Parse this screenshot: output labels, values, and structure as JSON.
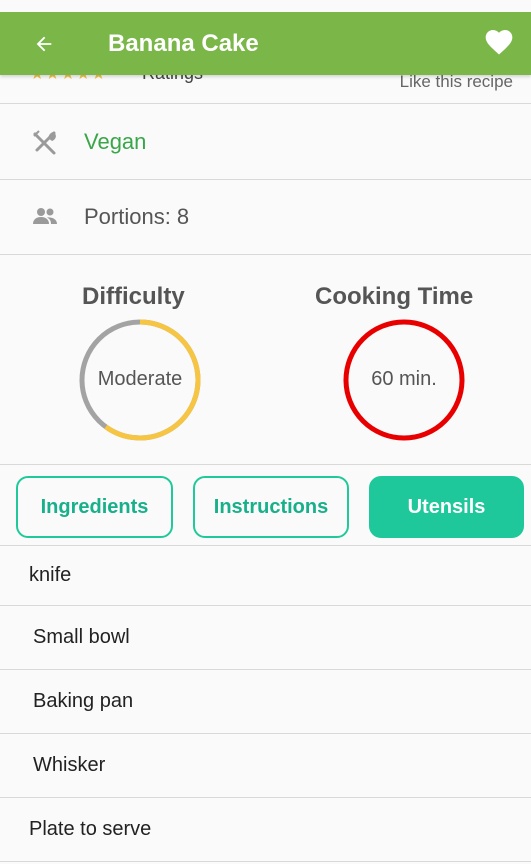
{
  "appbar": {
    "title": "Banana Cake",
    "back_icon": "arrow-left-icon",
    "favorite_icon": "heart-icon",
    "background": "#7ab648"
  },
  "rating": {
    "stars": "★★★★★",
    "ratings_label": "Ratings",
    "like_label": "Like this recipe"
  },
  "diet": {
    "icon": "utensils-cross-icon",
    "label": "Vegan",
    "color": "#3aa64a"
  },
  "portions": {
    "icon": "people-icon",
    "label": "Portions: 8"
  },
  "difficulty": {
    "title": "Difficulty",
    "value": "Moderate",
    "progress": 0.6,
    "ring_color": "#f5c543",
    "track_color": "#9e9e9e"
  },
  "cooking_time": {
    "title": "Cooking Time",
    "value": "60 min.",
    "progress": 1.0,
    "ring_color": "#e80000"
  },
  "tabs": [
    {
      "label": "Ingredients",
      "active": false
    },
    {
      "label": "Instructions",
      "active": false
    },
    {
      "label": "Utensils",
      "active": true
    }
  ],
  "accent_color": "#1ec89a",
  "utensils": [
    "knife",
    "Small bowl",
    "Baking pan",
    "Whisker",
    "Plate to serve"
  ]
}
